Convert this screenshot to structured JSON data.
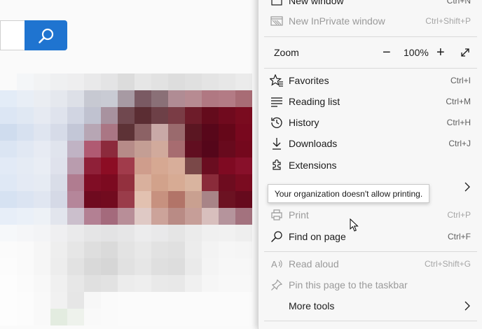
{
  "search": {
    "placeholder": "",
    "button_icon": "search-icon",
    "button_color": "#1f74d0"
  },
  "menu": {
    "items_top": [
      {
        "label": "New window",
        "shortcut": "Ctrl+N",
        "icon": "new-window-icon",
        "disabled": false
      },
      {
        "label": "New InPrivate window",
        "shortcut": "Ctrl+Shift+P",
        "icon": "inprivate-icon",
        "disabled": true
      }
    ],
    "zoom": {
      "label": "Zoom",
      "value": "100%",
      "minus": "−",
      "plus": "+",
      "fullscreen_icon": "fullscreen-icon"
    },
    "items_mid": [
      {
        "label": "Favorites",
        "shortcut": "Ctrl+I",
        "icon": "favorites-icon"
      },
      {
        "label": "Reading list",
        "shortcut": "Ctrl+M",
        "icon": "reading-list-icon"
      },
      {
        "label": "History",
        "shortcut": "Ctrl+H",
        "icon": "history-icon"
      },
      {
        "label": "Downloads",
        "shortcut": "Ctrl+J",
        "icon": "downloads-icon"
      },
      {
        "label": "Extensions",
        "shortcut": "",
        "icon": "extensions-icon"
      }
    ],
    "print": {
      "label": "Print",
      "shortcut": "Ctrl+P",
      "icon": "print-icon",
      "disabled": true
    },
    "find": {
      "label": "Find on page",
      "shortcut": "Ctrl+F",
      "icon": "find-icon"
    },
    "read_aloud": {
      "label": "Read aloud",
      "shortcut": "Ctrl+Shift+G",
      "icon": "read-aloud-icon",
      "disabled": true
    },
    "pin": {
      "label": "Pin this page to the taskbar",
      "icon": "pin-icon",
      "disabled": true
    },
    "more_tools": {
      "label": "More tools",
      "icon": "chevron-right-icon"
    }
  },
  "tooltip": {
    "text": "Your organization doesn't allow printing."
  },
  "colors": {
    "menu_bg": "#f7f7f7",
    "accent": "#1f74d0",
    "disabled": "#9a9a9a"
  }
}
